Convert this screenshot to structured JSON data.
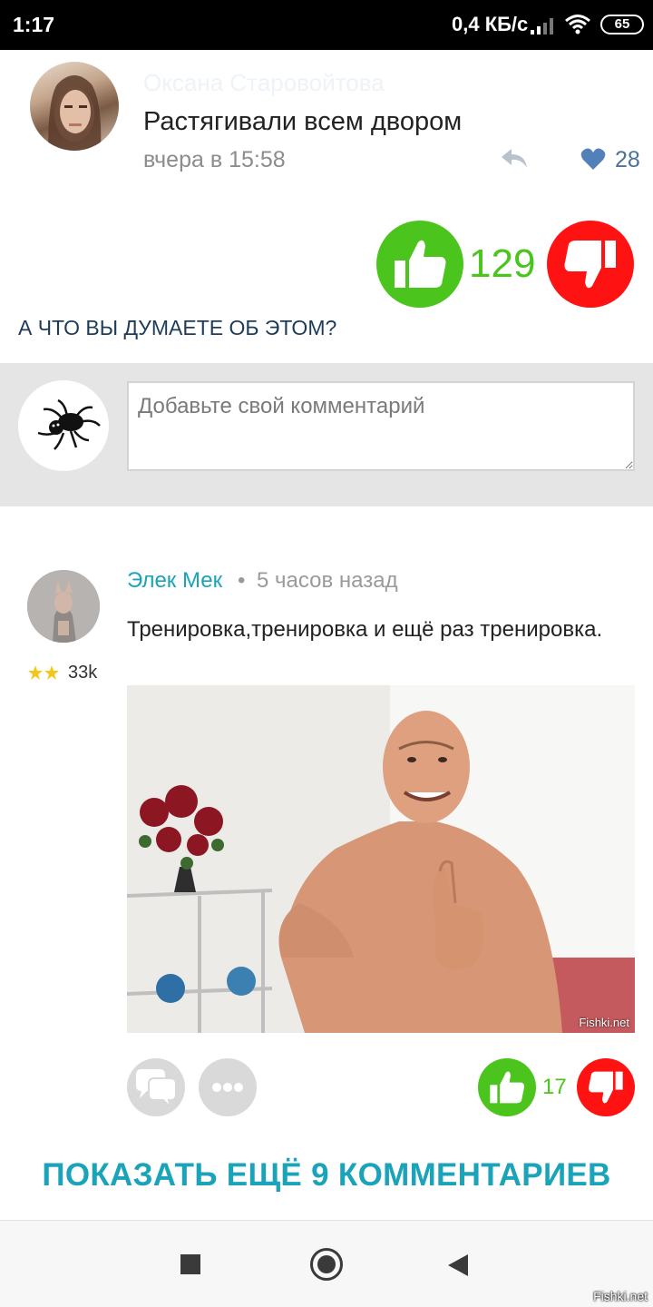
{
  "status_bar": {
    "time": "1:17",
    "network_speed": "0,4 КБ/с",
    "battery": "65"
  },
  "embedded_post": {
    "author": "Оксана Старовойтова",
    "text": "Растягивали всем двором",
    "time": "вчера в 15:58",
    "likes": "28"
  },
  "post_vote": {
    "count": "129"
  },
  "question": "А ЧТО ВЫ ДУМАЕТЕ ОБ ЭТОМ?",
  "compose": {
    "placeholder": "Добавьте свой комментарий"
  },
  "comment": {
    "author": "Элек Мек",
    "separator": "•",
    "time": "5 часов назад",
    "rating": "33k",
    "text": "Тренировка,тренировка и ещё раз тренировка.",
    "image_watermark": "Fishki.net",
    "votes": "17"
  },
  "show_more": "ПОКАЗАТЬ ЕЩЁ 9 КОММЕНТАРИЕВ",
  "site_watermark": "Fishki.net",
  "colors": {
    "accent": "#1ba3b9",
    "like": "#4bc51d",
    "dislike": "#ff1212",
    "heading": "#1d3c5a"
  }
}
